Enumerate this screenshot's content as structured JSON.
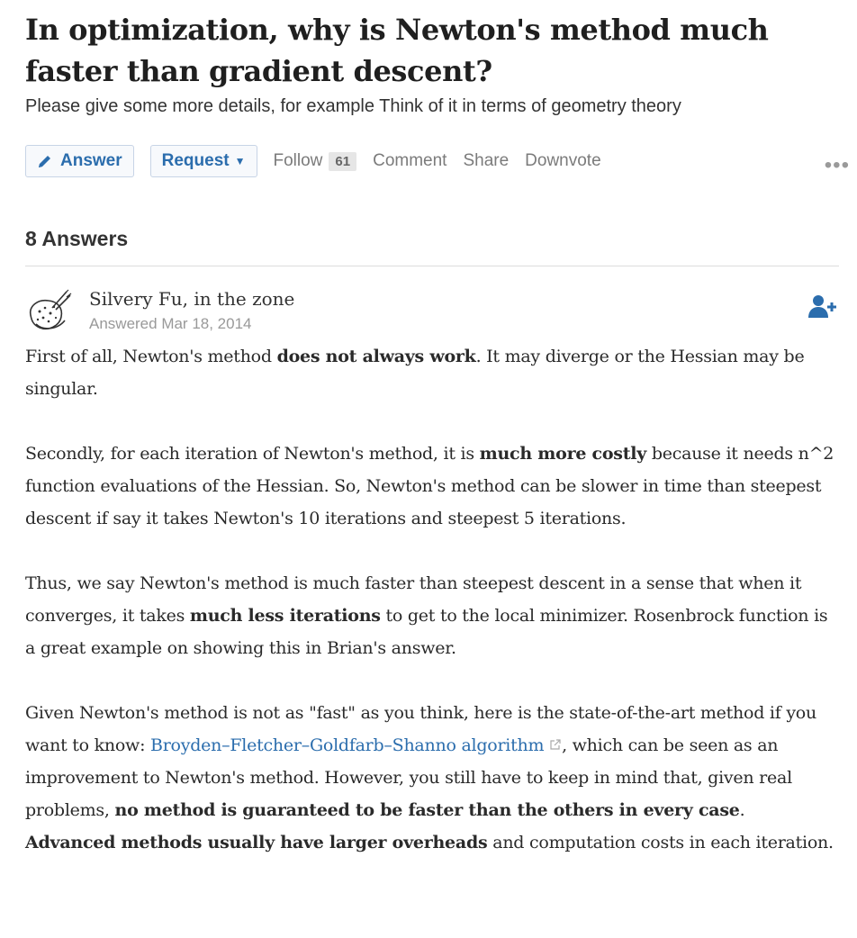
{
  "question": {
    "title": "In optimization, why is Newton's method much faster than gradient descent?",
    "details": "Please give some more details, for example Think of it in terms of  geometry theory"
  },
  "actions": {
    "answer_label": "Answer",
    "request_label": "Request",
    "follow_label": "Follow",
    "follow_count": "61",
    "comment_label": "Comment",
    "share_label": "Share",
    "downvote_label": "Downvote",
    "more_label": "•••"
  },
  "answers_count_label": "8 Answers",
  "answer": {
    "author": "Silvery Fu, in the zone",
    "answered": "Answered Mar 18, 2014",
    "p1": {
      "t1": "First of all, Newton's method ",
      "b1": "does not always work",
      "t2": ". It may diverge or the Hessian may be singular."
    },
    "p2": {
      "t1": "Secondly, for each iteration of Newton's method, it is ",
      "b1": "much more costly",
      "t2": " because it needs n^2 function evaluations of the Hessian. So, Newton's method can be slower in time than steepest descent if say it takes Newton's 10 iterations and steepest 5 iterations."
    },
    "p3": {
      "t1": "Thus, we say Newton's method is much faster than steepest descent in a sense that when it converges, it takes ",
      "b1": "much less iterations",
      "t2": " to get to the local minimizer. Rosenbrock function is a great example on showing this in Brian's answer."
    },
    "p4": {
      "t1": "Given Newton's method is not as \"fast\" as you think, here is the state-of-the-art method if you want to know: ",
      "link": "Broyden–Fletcher–Goldfarb–Shanno algorithm",
      "t2": ", which can be seen as an improvement to Newton's method. However, you still have to keep in mind that, given real problems, ",
      "b1": "no method is guaranteed to be faster than the others in every case",
      "t3": ". ",
      "b2": "Advanced methods usually have larger overheads",
      "t4": " and computation costs in each iteration."
    }
  },
  "colors": {
    "link": "#2b6dad",
    "muted": "#999999",
    "button_border": "#c7d4e6"
  }
}
